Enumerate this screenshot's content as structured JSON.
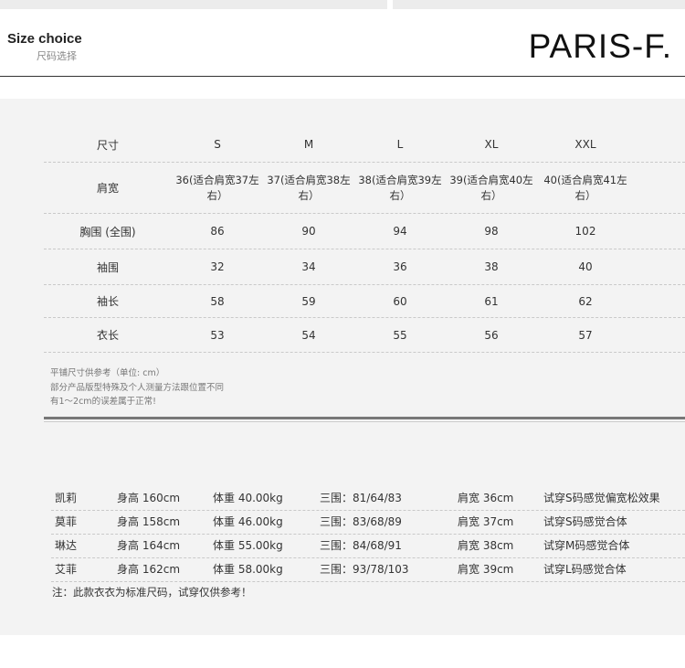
{
  "header": {
    "title_en": "Size choice",
    "title_cn": "尺码选择",
    "brand": "PARIS-F."
  },
  "size_table": {
    "headers": [
      "尺寸",
      "S",
      "M",
      "L",
      "XL",
      "XXL"
    ],
    "rows": [
      {
        "label": "肩宽",
        "values": [
          "36(适合肩宽37左右）",
          "37(适合肩宽38左右）",
          "38(适合肩宽39左右）",
          "39(适合肩宽40左右）",
          "40(适合肩宽41左右）"
        ]
      },
      {
        "label": "胸围 (全围)",
        "values": [
          "86",
          "90",
          "94",
          "98",
          "102"
        ]
      },
      {
        "label": "袖围",
        "values": [
          "32",
          "34",
          "36",
          "38",
          "40"
        ]
      },
      {
        "label": "袖长",
        "values": [
          "58",
          "59",
          "60",
          "61",
          "62"
        ]
      },
      {
        "label": "衣长",
        "values": [
          "53",
          "54",
          "55",
          "56",
          "57"
        ]
      }
    ],
    "notes": [
      "平铺尺寸供参考（单位: cm）",
      "部分产品版型特殊及个人测量方法跟位置不同",
      "有1～2cm的误差属于正常!"
    ]
  },
  "models": {
    "rows": [
      {
        "name": "凯莉",
        "height": "身高 160cm",
        "weight": "体重 40.00kg",
        "measurements": "三围：81/64/83",
        "shoulder": "肩宽 36cm",
        "fit": "试穿S码感觉偏宽松效果"
      },
      {
        "name": "莫菲",
        "height": "身高 158cm",
        "weight": "体重 46.00kg",
        "measurements": "三围：83/68/89",
        "shoulder": "肩宽 37cm",
        "fit": "试穿S码感觉合体"
      },
      {
        "name": "琳达",
        "height": "身高 164cm",
        "weight": "体重 55.00kg",
        "measurements": "三围：84/68/91",
        "shoulder": "肩宽 38cm",
        "fit": "试穿M码感觉合体"
      },
      {
        "name": "艾菲",
        "height": "身高 162cm",
        "weight": "体重 58.00kg",
        "measurements": "三围：93/78/103",
        "shoulder": "肩宽 39cm",
        "fit": "试穿L码感觉合体"
      }
    ],
    "note": "注：此款衣衣为标准尺码，试穿仅供参考！"
  }
}
